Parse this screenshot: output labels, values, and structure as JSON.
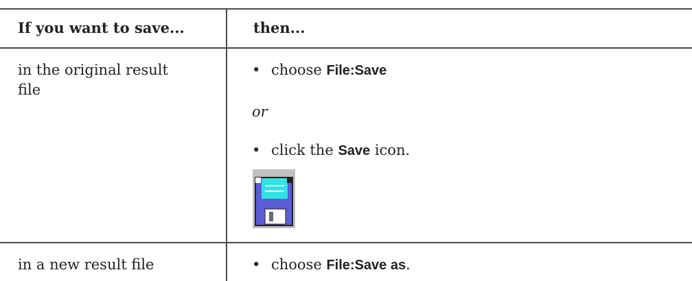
{
  "table": {
    "header": {
      "col1": "If you want to save...",
      "col2": "then..."
    },
    "rows": [
      {
        "condition_line1": "in the original result",
        "condition_line2": "file",
        "steps": [
          {
            "bullet": "•",
            "prefix": "choose ",
            "term": "File:Save",
            "suffix": ""
          },
          {
            "or": "or"
          },
          {
            "bullet": "•",
            "prefix": "click the ",
            "term": "Save",
            "suffix": " icon."
          }
        ],
        "icon": "floppy-disk-save-icon"
      },
      {
        "condition_line1": "in a new result file",
        "steps": [
          {
            "bullet": "•",
            "prefix": "choose ",
            "term": "File:Save as",
            "suffix": "."
          }
        ]
      }
    ]
  },
  "colors": {
    "rule": "#4a4a4a",
    "icon_bg": "#c0c0c0",
    "icon_body": "#5b5bd6",
    "icon_label": "#2fe3e3",
    "icon_shutter": "#ffffff"
  }
}
